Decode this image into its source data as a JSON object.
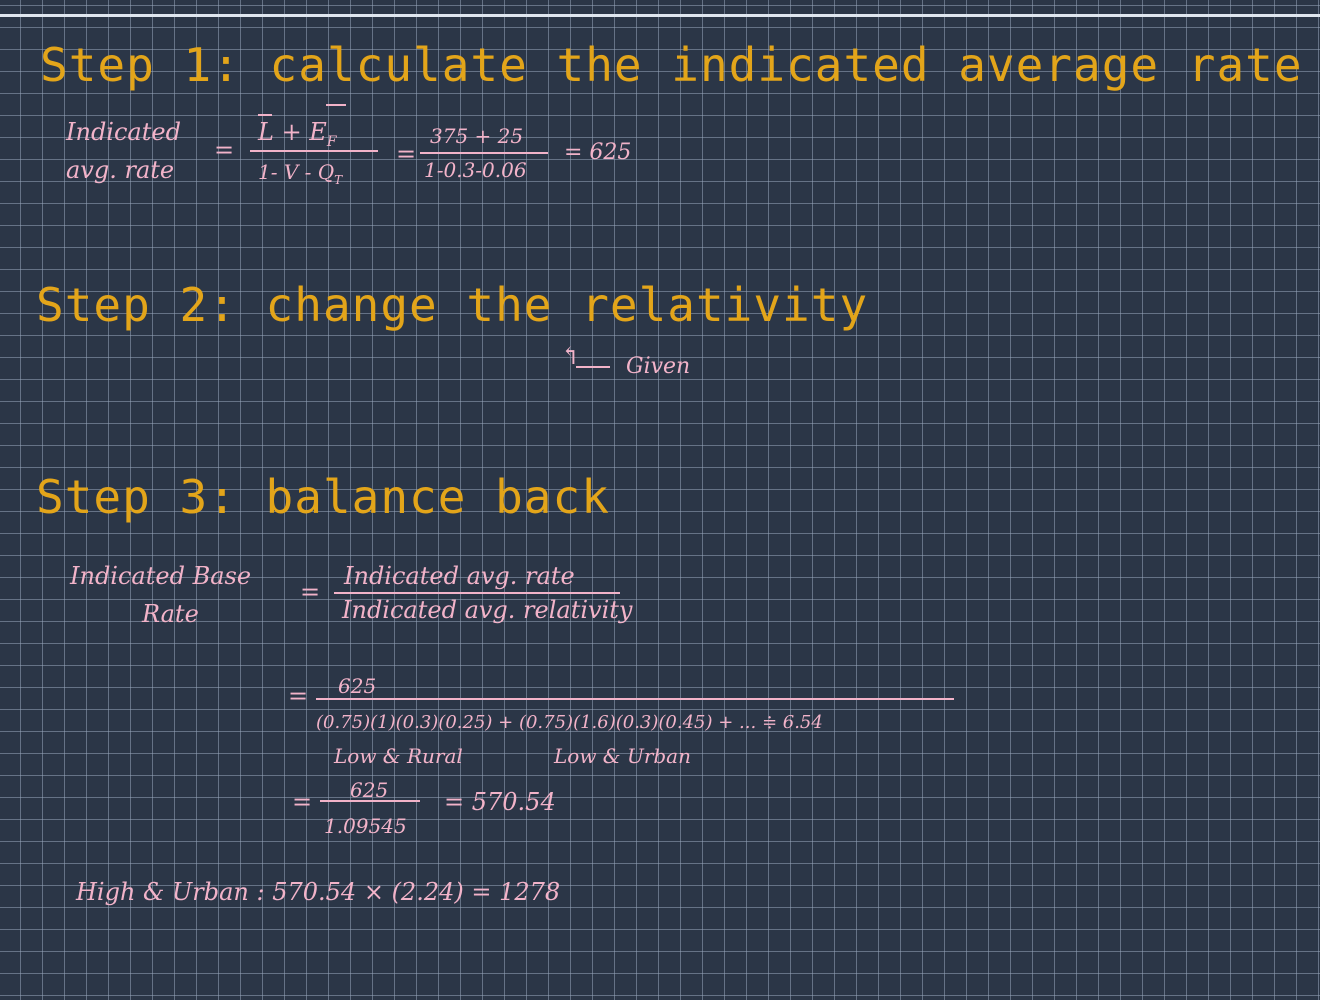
{
  "step1": {
    "heading": "Step 1: calculate the indicated average rate",
    "lhs_line1": "Indicated",
    "lhs_line2": "avg. rate",
    "eq": "=",
    "num1": "L + E",
    "num1_sub": "F",
    "den1": "1- V - Q",
    "den1_sub": "T",
    "num2": "375 + 25",
    "den2": "1-0.3-0.06",
    "result": "= 625"
  },
  "step2": {
    "heading": "Step 2: change the relativity",
    "arrow": "↰",
    "note": "Given"
  },
  "step3": {
    "heading": "Step 3: balance back",
    "lhs_line1": "Indicated  Base",
    "lhs_line2": "Rate",
    "eq": "=",
    "num": "Indicated  avg.  rate",
    "den": "Indicated  avg.  relativity",
    "eq2": "=",
    "num2": "625",
    "den2": "(0.75)(1)(0.3)(0.25) + (0.75)(1.6)(0.3)(0.45) + ...  ≑  6.54",
    "label_a": "Low & Rural",
    "label_b": "Low & Urban",
    "eq3": "=",
    "num3": "625",
    "den3": "1.09545",
    "result3": "= 570.54",
    "final": "High & Urban :  570.54 × (2.24) = 1278"
  }
}
